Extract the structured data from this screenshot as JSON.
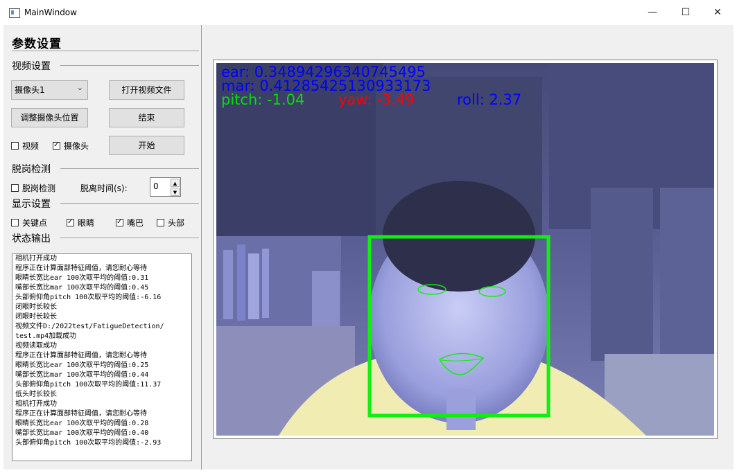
{
  "window": {
    "title": "MainWindow",
    "minimize": "—",
    "maximize": "☐",
    "close": "✕"
  },
  "left": {
    "heading": "参数设置",
    "video_section": {
      "title": "视频设置",
      "camera_select": "摄像头1",
      "open_file_button": "打开视频文件",
      "adjust_camera_button": "调整摄像头位置",
      "end_button": "结束",
      "start_button": "开始",
      "video_checkbox": {
        "label": "视频",
        "checked": false
      },
      "camera_checkbox": {
        "label": "摄像头",
        "checked": true
      }
    },
    "absence_section": {
      "title": "脱岗检测",
      "checkbox": {
        "label": "脱岗检测",
        "checked": false
      },
      "time_label": "脱离时间(s):",
      "time_value": "0"
    },
    "display_section": {
      "title": "显示设置",
      "keypoints": {
        "label": "关键点",
        "checked": false
      },
      "eyes": {
        "label": "眼睛",
        "checked": true
      },
      "mouth": {
        "label": "嘴巴",
        "checked": true
      },
      "head": {
        "label": "头部",
        "checked": false
      }
    },
    "status_section": {
      "title": "状态输出",
      "lines": [
        "相机打开成功",
        "程序正在计算面部特征阈值，请您耐心等待",
        "眼睛长宽比ear 100次取平均的阈值:0.31",
        "嘴部长宽比mar 100次取平均的阈值:0.45",
        "头部俯仰角pitch 100次取平均的阈值:-6.16",
        "闭眼时长较长",
        "闭眼时长较长",
        "视频文件D:/2022test/FatigueDetection/",
        "test.mp4加载成功",
        "视频读取成功",
        "程序正在计算面部特征阈值，请您耐心等待",
        "眼睛长宽比ear 100次取平均的阈值:0.25",
        "嘴部长宽比mar 100次取平均的阈值:0.44",
        "头部俯仰角pitch 100次取平均的阈值:11.37",
        "低头时长较长",
        "相机打开成功",
        "程序正在计算面部特征阈值，请您耐心等待",
        "眼睛长宽比ear 100次取平均的阈值:0.28",
        "嘴部长宽比mar 100次取平均的阈值:0.40",
        "头部俯仰角pitch 100次取平均的阈值:-2.93"
      ]
    }
  },
  "video": {
    "ear_text": "ear: 0.34894296340745495",
    "mar_text": "mar: 0.41285425130933173",
    "pitch_text": "pitch: -1.04",
    "yaw_text": "yaw: -3.49",
    "roll_text": "roll:  2.37",
    "colors": {
      "blue": "#0000ff",
      "green": "#00e000",
      "red": "#ff0000",
      "face_box": "#11ee11"
    }
  }
}
